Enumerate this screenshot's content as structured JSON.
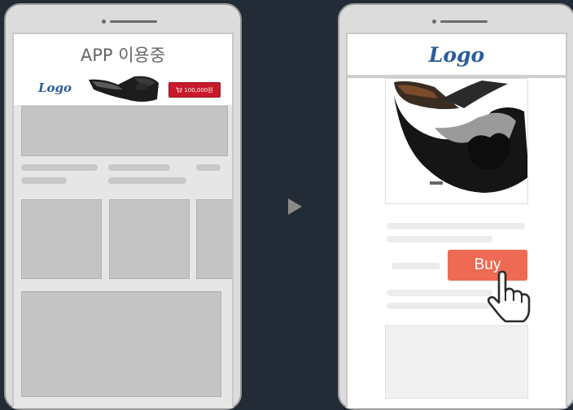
{
  "left_phone": {
    "title": "APP 이용중",
    "banner": {
      "logo": "Logo",
      "price_label": "100,000원"
    }
  },
  "right_phone": {
    "logo": "Logo",
    "buy_label": "Buy"
  },
  "icons": [
    "cart-icon",
    "play-arrow-icon",
    "pointer-hand-icon",
    "shoe-product-image"
  ],
  "colors": {
    "background": "#232b36",
    "buy_button": "#ee6a54",
    "price_button": "#c8192b",
    "logo": "#2a5d99"
  }
}
